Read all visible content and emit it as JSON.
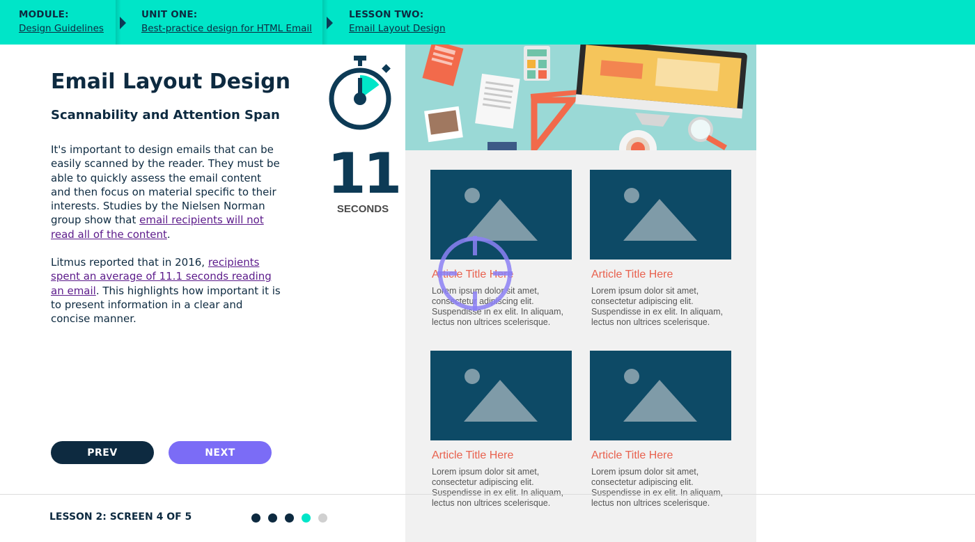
{
  "breadcrumbs": [
    {
      "heading": "MODULE:",
      "link": "Design Guidelines"
    },
    {
      "heading": "UNIT ONE:",
      "link": "Best-practice design for HTML Email"
    },
    {
      "heading": "LESSON TWO:",
      "link": "Email Layout Design"
    }
  ],
  "content": {
    "title": "Email Layout Design",
    "subtitle": "Scannability and Attention Span",
    "para1_text": "It's important to design emails that can be easily scanned by the reader. They must be able to quickly assess the email content and then focus on material specific to their interests. Studies by the Nielsen Norman group show that ",
    "para1_link": "email recipients will not read all of the content",
    "para1_end": ".",
    "para2_text": "Litmus reported that in 2016, ",
    "para2_link": "recipients spent an average of 11.1 seconds reading an email",
    "para2_end": ". This highlights how important it is to present information in a clear and concise manner."
  },
  "nav": {
    "prev_label": "PREV",
    "next_label": "NEXT"
  },
  "timer": {
    "value": "11",
    "unit": "SECONDS",
    "progress": 0.15
  },
  "email_preview": {
    "articles": [
      {
        "title": "Article Title Here",
        "body": "Lorem ipsum dolor sit amet, consectetur adipiscing elit. Suspendisse in ex elit. In aliquam, lectus non ultrices scelerisque."
      },
      {
        "title": "Article Title Here",
        "body": "Lorem ipsum dolor sit amet, consectetur adipiscing elit. Suspendisse in ex elit. In aliquam, lectus non ultrices scelerisque."
      },
      {
        "title": "Article Title Here",
        "body": "Lorem ipsum dolor sit amet, consectetur adipiscing elit. Suspendisse in ex elit. In aliquam, lectus non ultrices scelerisque."
      },
      {
        "title": "Article Title Here",
        "body": "Lorem ipsum dolor sit amet, consectetur adipiscing elit. Suspendisse in ex elit. In aliquam, lectus non ultrices scelerisque."
      }
    ]
  },
  "footer": {
    "label": "LESSON 2: SCREEN 4 OF 5",
    "current_screen": 4,
    "total_screens": 5
  },
  "colors": {
    "accent": "#00e5c8",
    "navy": "#0d2a40",
    "next_button": "#7b6cf6",
    "article_title": "#e8614e",
    "thumb_bg": "#0d4a66",
    "dot_inactive": "#d0d0d0"
  },
  "icons": [
    "stopwatch-icon",
    "crosshair-icon",
    "image-placeholder-icon",
    "chevron-right-icon"
  ]
}
